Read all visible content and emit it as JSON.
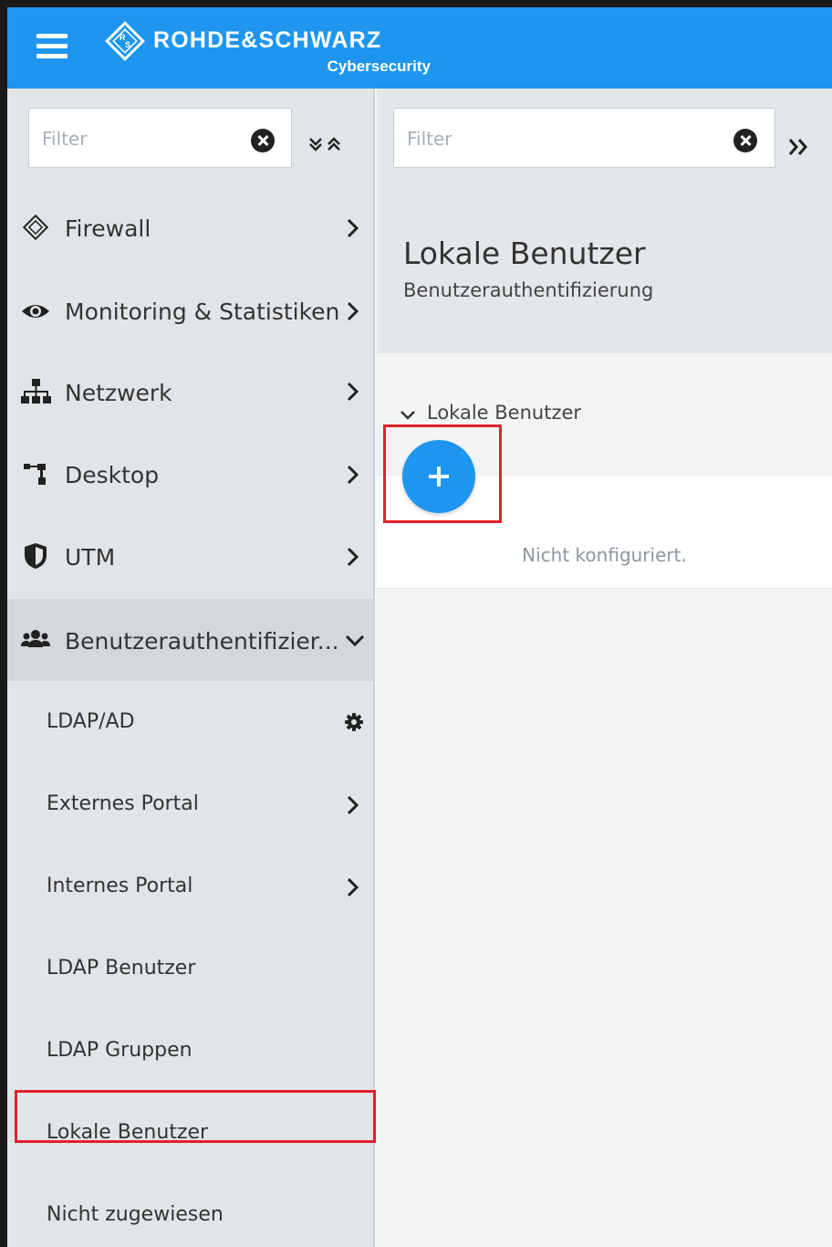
{
  "header": {
    "brand": "ROHDE&SCHWARZ",
    "brand_sub": "Cybersecurity",
    "accent_color": "#1e96f0"
  },
  "sidebar": {
    "filter_placeholder": "Filter",
    "items": [
      {
        "label": "Firewall",
        "icon": "firewall-icon"
      },
      {
        "label": "Monitoring & Statistiken",
        "icon": "eye-icon"
      },
      {
        "label": "Netzwerk",
        "icon": "network-icon"
      },
      {
        "label": "Desktop",
        "icon": "desktop-icon"
      },
      {
        "label": "UTM",
        "icon": "shield-icon"
      },
      {
        "label": "Benutzerauthentifizier...",
        "icon": "users-icon",
        "expanded": true
      }
    ],
    "sub_items": [
      {
        "label": "LDAP/AD",
        "icon": "gear-icon"
      },
      {
        "label": "Externes Portal"
      },
      {
        "label": "Internes Portal"
      },
      {
        "label": "LDAP Benutzer"
      },
      {
        "label": "LDAP Gruppen"
      },
      {
        "label": "Lokale Benutzer",
        "selected": true
      },
      {
        "label": "Nicht zugewiesen"
      }
    ]
  },
  "main": {
    "filter_placeholder": "Filter",
    "title": "Lokale Benutzer",
    "subtitle": "Benutzerauthentifizierung",
    "section_label": "Lokale Benutzer",
    "empty_text": "Nicht konfiguriert.",
    "highlight_color": "#e3202b"
  }
}
